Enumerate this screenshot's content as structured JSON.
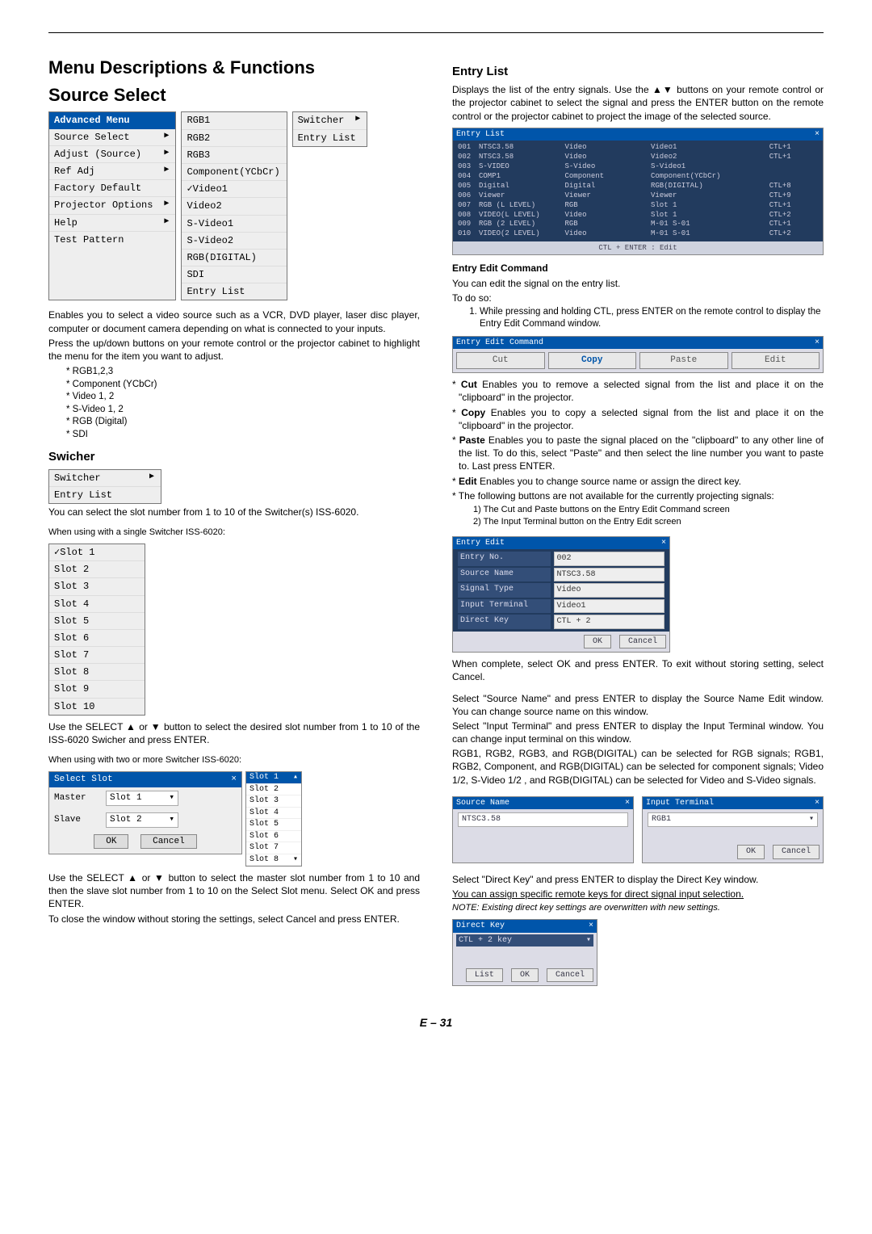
{
  "title_line1": "Menu Descriptions & Functions",
  "title_line2": "Source Select",
  "advanced_menu": {
    "header": "Advanced Menu",
    "items": [
      {
        "label": "Source Select",
        "arrow": "▶"
      },
      {
        "label": "Adjust (Source)",
        "arrow": "▶"
      },
      {
        "label": "Ref Adj",
        "arrow": "▶"
      },
      {
        "label": "Factory Default",
        "arrow": ""
      },
      {
        "label": "Projector Options",
        "arrow": "▶"
      },
      {
        "label": "Help",
        "arrow": "▶"
      },
      {
        "label": "Test Pattern",
        "arrow": ""
      }
    ]
  },
  "source_menu": {
    "items": [
      "RGB1",
      "RGB2",
      "RGB3",
      "Component(YCbCr)",
      "✓Video1",
      "Video2",
      "S-Video1",
      "S-Video2",
      "RGB(DIGITAL)",
      "SDI",
      "Entry List"
    ]
  },
  "switcher_menu": {
    "items": [
      {
        "label": "Switcher",
        "arrow": "▶"
      },
      {
        "label": "Entry List",
        "arrow": ""
      }
    ]
  },
  "intro_p1": "Enables you to select a video source such as a VCR, DVD player, laser disc player, computer or document camera depending on what is connected to your inputs.",
  "intro_p2": "Press the up/down buttons on your remote control or the projector cabinet to highlight the menu for the item you want to adjust.",
  "source_bullets": [
    "RGB1,2,3",
    "Component (YCbCr)",
    "Video 1, 2",
    "S-Video 1, 2",
    "RGB (Digital)",
    "SDI"
  ],
  "swicher_h": "Swicher",
  "swicher_sub": {
    "items": [
      {
        "label": "Switcher",
        "arrow": "▶"
      },
      {
        "label": "Entry List",
        "arrow": ""
      }
    ]
  },
  "swicher_p1": "You can select the slot number from 1 to 10 of the Switcher(s) ISS-6020.",
  "swicher_p2": "When using with a single Switcher ISS-6020:",
  "slot_single": [
    "✓Slot 1",
    "Slot 2",
    "Slot 3",
    "Slot 4",
    "Slot 5",
    "Slot 6",
    "Slot 7",
    "Slot 8",
    "Slot 9",
    "Slot 10"
  ],
  "swicher_p3": "Use the SELECT ▲ or ▼ button to select the desired slot number from 1 to 10 of the ISS-6020 Swicher and press ENTER.",
  "swicher_p4": "When using with two or more Switcher ISS-6020:",
  "select_slot": {
    "title": "Select Slot",
    "master": "Master",
    "master_val": "Slot 1",
    "slave": "Slave",
    "slave_val": "Slot 2",
    "ok": "OK",
    "cancel": "Cancel",
    "list": [
      "Slot 1",
      "Slot 2",
      "Slot 3",
      "Slot 4",
      "Slot 5",
      "Slot 6",
      "Slot 7",
      "Slot 8"
    ]
  },
  "swicher_p5": "Use the SELECT ▲ or ▼ button to select the master slot number from 1 to 10 and then the slave slot number from 1 to 10 on the Select Slot menu. Select OK and press ENTER.",
  "swicher_p6": "To close the window without storing the settings, select Cancel and press ENTER.",
  "entry_list_h": "Entry List",
  "entry_list_p": "Displays the list of the entry signals. Use the ▲▼ buttons on your remote control or the projector cabinet to select the signal and press the ENTER button on the remote control or the projector cabinet to project the image of the selected source.",
  "entry_list_table": {
    "title": "Entry List",
    "footer": "CTL + ENTER : Edit",
    "rows": [
      [
        "001",
        "NTSC3.58",
        "Video",
        "Video1",
        "CTL+1"
      ],
      [
        "002",
        "NTSC3.58",
        "Video",
        "Video2",
        "CTL+1"
      ],
      [
        "003",
        "S-VIDEO",
        "S-Video",
        "S-Video1",
        ""
      ],
      [
        "004",
        "COMP1",
        "Component",
        "Component(YCbCr)",
        ""
      ],
      [
        "005",
        "Digital",
        "Digital",
        "RGB(DIGITAL)",
        "CTL+8"
      ],
      [
        "006",
        "Viewer",
        "Viewer",
        "Viewer",
        "CTL+9"
      ],
      [
        "007",
        "RGB  (L LEVEL)",
        "RGB",
        "Slot 1",
        "CTL+1"
      ],
      [
        "008",
        "VIDEO(L LEVEL)",
        "Video",
        "Slot 1",
        "CTL+2"
      ],
      [
        "009",
        "RGB  (2 LEVEL)",
        "RGB",
        "M-01 S-01",
        "CTL+1"
      ],
      [
        "010",
        "VIDEO(2 LEVEL)",
        "Video",
        "M-01 S-01",
        "CTL+2"
      ]
    ]
  },
  "entry_edit_cmd_h": "Entry Edit Command",
  "entry_edit_p1": "You can edit the signal on the entry list.",
  "entry_edit_p2": "To do so:",
  "entry_edit_step": "While pressing and holding CTL, press ENTER on the remote control to display the Entry Edit Command window.",
  "entry_edit_window": {
    "title": "Entry Edit Command",
    "buttons": [
      "Cut",
      "Copy",
      "Paste",
      "Edit"
    ]
  },
  "edit_bullets": [
    {
      "b": "Cut",
      "t": " Enables you to remove a selected signal from the list and place it on the \"clipboard\" in the projector."
    },
    {
      "b": "Copy",
      "t": " Enables you to copy a selected signal from the list and place it on the \"clipboard\" in the projector."
    },
    {
      "b": "Paste",
      "t": " Enables you to paste the signal placed on the \"clipboard\" to any other line of the list. To do this, select \"Paste\" and then select the line number you want to paste to. Last press ENTER."
    },
    {
      "b": "Edit",
      "t": " Enables you to change source name or assign the direct key."
    },
    {
      "b": "",
      "t": "The following buttons are not available for the currently projecting signals:"
    }
  ],
  "edit_sub": [
    "1) The Cut and Paste buttons on the Entry Edit Command screen",
    "2) The Input Terminal button on the Entry Edit screen"
  ],
  "entry_edit_form": {
    "title": "Entry Edit",
    "rows": [
      {
        "lab": "Entry No.",
        "val": "002"
      },
      {
        "lab": "Source Name",
        "val": "NTSC3.58"
      },
      {
        "lab": "Signal Type",
        "val": "Video"
      },
      {
        "lab": "Input Terminal",
        "val": "Video1"
      },
      {
        "lab": "Direct Key",
        "val": "CTL + 2"
      }
    ],
    "ok": "OK",
    "cancel": "Cancel"
  },
  "after_form_p1": "When complete, select OK and press ENTER. To exit without storing setting, select Cancel.",
  "after_form_p2": "Select \"Source Name\" and press ENTER to display the Source Name Edit window. You can change source name on this window.",
  "after_form_p3": "Select \"Input Terminal\" and press ENTER to display the Input Terminal window. You can change input terminal on this window.",
  "after_form_p4": "RGB1, RGB2, RGB3, and RGB(DIGITAL) can be selected for RGB signals; RGB1, RGB2, Component, and RGB(DIGITAL) can be selected for component signals; Video 1/2, S-Video 1/2 , and RGB(DIGITAL) can be selected for Video and S-Video signals.",
  "source_name_box": {
    "title": "Source Name",
    "val": "NTSC3.58"
  },
  "input_term_box": {
    "title": "Input Terminal",
    "val": "RGB1",
    "ok": "OK",
    "cancel": "Cancel"
  },
  "directkey_p1": "Select \"Direct Key\" and press ENTER to display the Direct Key window.",
  "directkey_p2": "You can assign specific remote keys for direct signal input selection.",
  "directkey_note": "NOTE: Existing direct key settings are overwritten with new settings.",
  "direct_key_box": {
    "title": "Direct Key",
    "val": "CTL + 2 key",
    "list": "List",
    "ok": "OK",
    "cancel": "Cancel"
  },
  "page_num": "E – 31"
}
